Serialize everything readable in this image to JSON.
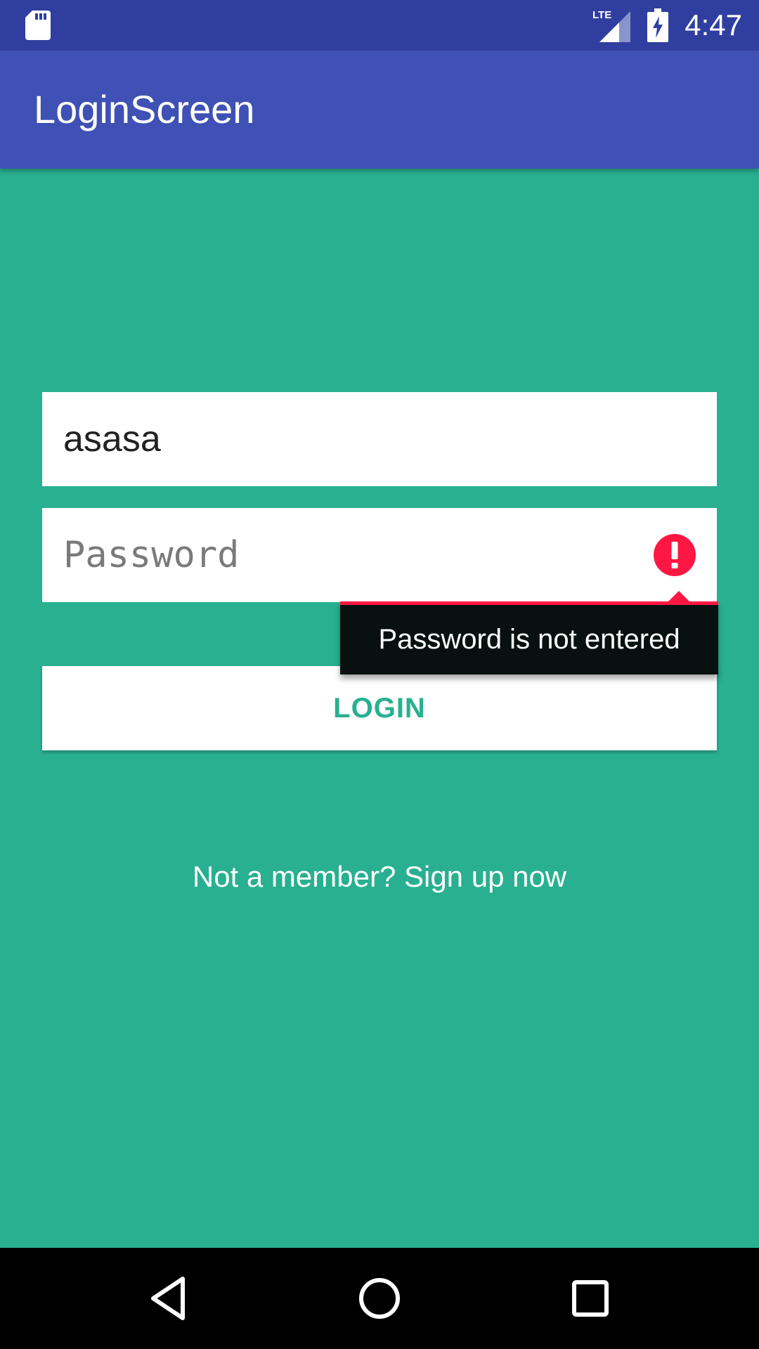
{
  "status_bar": {
    "time": "4:47",
    "network_label": "LTE",
    "icons": [
      "sd-card-icon",
      "lte-signal-icon",
      "battery-charging-icon"
    ]
  },
  "app_bar": {
    "title": "LoginScreen",
    "color": "#3f51b5"
  },
  "login_form": {
    "username": {
      "value": "asasa",
      "placeholder": ""
    },
    "password": {
      "value": "",
      "placeholder": "Password",
      "error_icon": "error-exclamation-icon"
    },
    "error_message": "Password is not entered",
    "login_label": "LOGIN"
  },
  "signup_text": "Not a member? Sign up now",
  "navigation_bar": {
    "buttons": [
      "back-icon",
      "home-icon",
      "recents-icon"
    ]
  },
  "colors": {
    "background": "#28b090",
    "status_bar": "#303f9f",
    "error_accent": "#ff1744",
    "error_popup": "#08110f"
  }
}
